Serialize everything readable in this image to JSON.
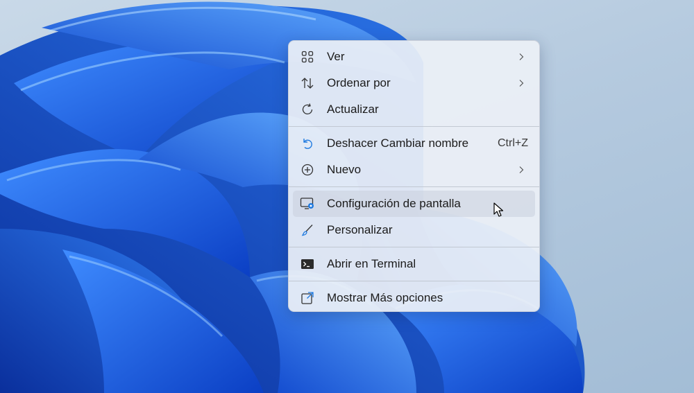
{
  "colors": {
    "accent": "#1f7ae0",
    "wallpaper_dark": "#0a35b5",
    "wallpaper_light": "#4aa0ff",
    "menu_background": "#ecf0f6",
    "text": "#1b1b1b"
  },
  "context_menu": {
    "items": [
      {
        "label": "Ver",
        "icon": "grid-view-icon",
        "has_submenu": true
      },
      {
        "label": "Ordenar por",
        "icon": "sort-arrows-icon",
        "has_submenu": true
      },
      {
        "label": "Actualizar",
        "icon": "refresh-icon",
        "has_submenu": false
      },
      {
        "label": "Deshacer Cambiar nombre",
        "icon": "undo-icon",
        "shortcut": "Ctrl+Z"
      },
      {
        "label": "Nuevo",
        "icon": "add-circle-icon",
        "has_submenu": true
      },
      {
        "label": "Configuración de pantalla",
        "icon": "display-settings-icon",
        "hovered": true
      },
      {
        "label": "Personalizar",
        "icon": "paint-brush-icon"
      },
      {
        "label": "Abrir en Terminal",
        "icon": "terminal-icon"
      },
      {
        "label": "Mostrar Más opciones",
        "icon": "open-external-icon"
      }
    ]
  }
}
